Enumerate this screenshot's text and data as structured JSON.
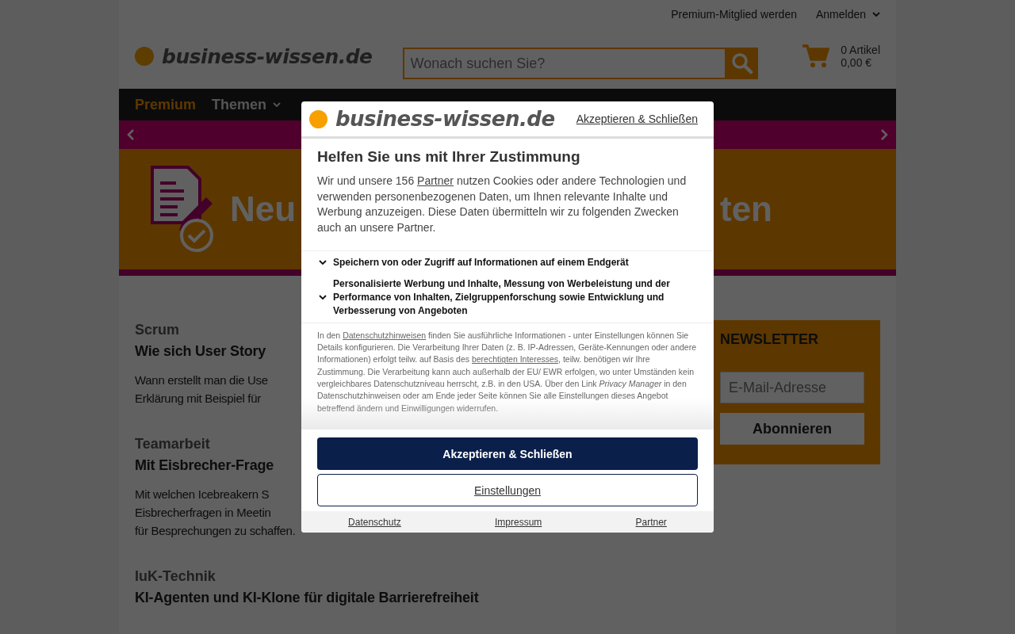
{
  "topbar": {
    "links": [
      {
        "label": "Premium-Mitglied werden",
        "dropdown": false
      },
      {
        "label": "Anmelden",
        "dropdown": true
      }
    ]
  },
  "header": {
    "logo": "business-wissen.de",
    "search": {
      "placeholder": "Wonach suchen Sie?"
    },
    "cart": {
      "count": "0 Artikel",
      "total": "0,00 €"
    }
  },
  "nav": [
    {
      "label": "Premium",
      "highlight": true,
      "dropdown": false
    },
    {
      "label": "Themen",
      "highlight": false,
      "dropdown": true
    }
  ],
  "banner": {
    "title_start": "Neu",
    "title_end": "ten"
  },
  "articles": [
    {
      "category": "Scrum",
      "title": "Wie sich User Story",
      "teaser": [
        "Wann erstellt man die Use",
        "Erklärung mit Beispiel für"
      ]
    },
    {
      "category": "Teamarbeit",
      "title": "Mit Eisbrecher-Frage",
      "teaser": [
        "Mit welchen Icebreakern S",
        "Eisbrecherfragen in Meetin",
        "für Besprechungen zu schaffen."
      ]
    },
    {
      "category": "IuK-Technik",
      "title": "KI-Agenten und KI-Klone für digitale Barrierefreiheit"
    }
  ],
  "newsletter": {
    "title": "NEWSLETTER",
    "placeholder": "E-Mail-Adresse",
    "button": "Abonnieren"
  },
  "consent": {
    "logo": "business-wissen.de",
    "header_link": "Akzeptieren & Schließen",
    "heading": "Helfen Sie uns mit Ihrer Zustimmung",
    "intro": [
      {
        "kind": "text",
        "text": "Wir und unsere 156 "
      },
      {
        "kind": "link",
        "text": "Partner"
      },
      {
        "kind": "text",
        "text": " nutzen Cookies oder andere Technologien und verwenden personenbezogenen Daten, um Ihnen relevante Inhalte und Werbung anzuzeigen. Diese Daten übermitteln wir zu folgenden Zwecken auch an unsere Partner."
      }
    ],
    "purposes": [
      {
        "label": "Speichern von oder Zugriff auf Informationen auf einem Endgerät",
        "expanded": false
      },
      {
        "label": "Personalisierte Werbung und Inhalte, Messung von Werbeleistung und der Performance von Inhalten, Zielgruppenforschung sowie Entwicklung und Verbesserung von Angeboten",
        "expanded": false
      }
    ],
    "legal": [
      {
        "kind": "text",
        "text": "In den "
      },
      {
        "kind": "link",
        "text": "Datenschutzhinweisen"
      },
      {
        "kind": "text",
        "text": " finden Sie ausführliche Informationen - unter Einstellungen können Sie Details konfigurieren. Die Verarbeitung Ihrer Daten (z. B. IP-Adressen, Geräte-Kennungen oder andere Informationen) erfolgt teilw. auf Basis des "
      },
      {
        "kind": "link",
        "text": "berechtigten Interesses"
      },
      {
        "kind": "text",
        "text": ", teilw. benötigen wir Ihre Zustimmung. Die Verarbeitung kann auch außerhalb der EU/ EWR erfolgen, wo unter Umständen kein vergleichbares Datenschutzniveau herrscht, z.B. in den USA. Über den Link "
      },
      {
        "kind": "em",
        "text": "Privacy Manager"
      },
      {
        "kind": "text",
        "text": " in den Datenschutzhinweisen oder am Ende jeder Seite können Sie alle Einstellungen dieses Angebot betreffend ändern und Einwilligungen widerrufen."
      }
    ],
    "buttons": [
      {
        "label": "Akzeptieren & Schließen",
        "kind": "primary"
      },
      {
        "label": "Einstellungen",
        "kind": "secondary"
      }
    ],
    "footer_links": [
      "Datenschutz",
      "Impressum",
      "Partner"
    ]
  }
}
